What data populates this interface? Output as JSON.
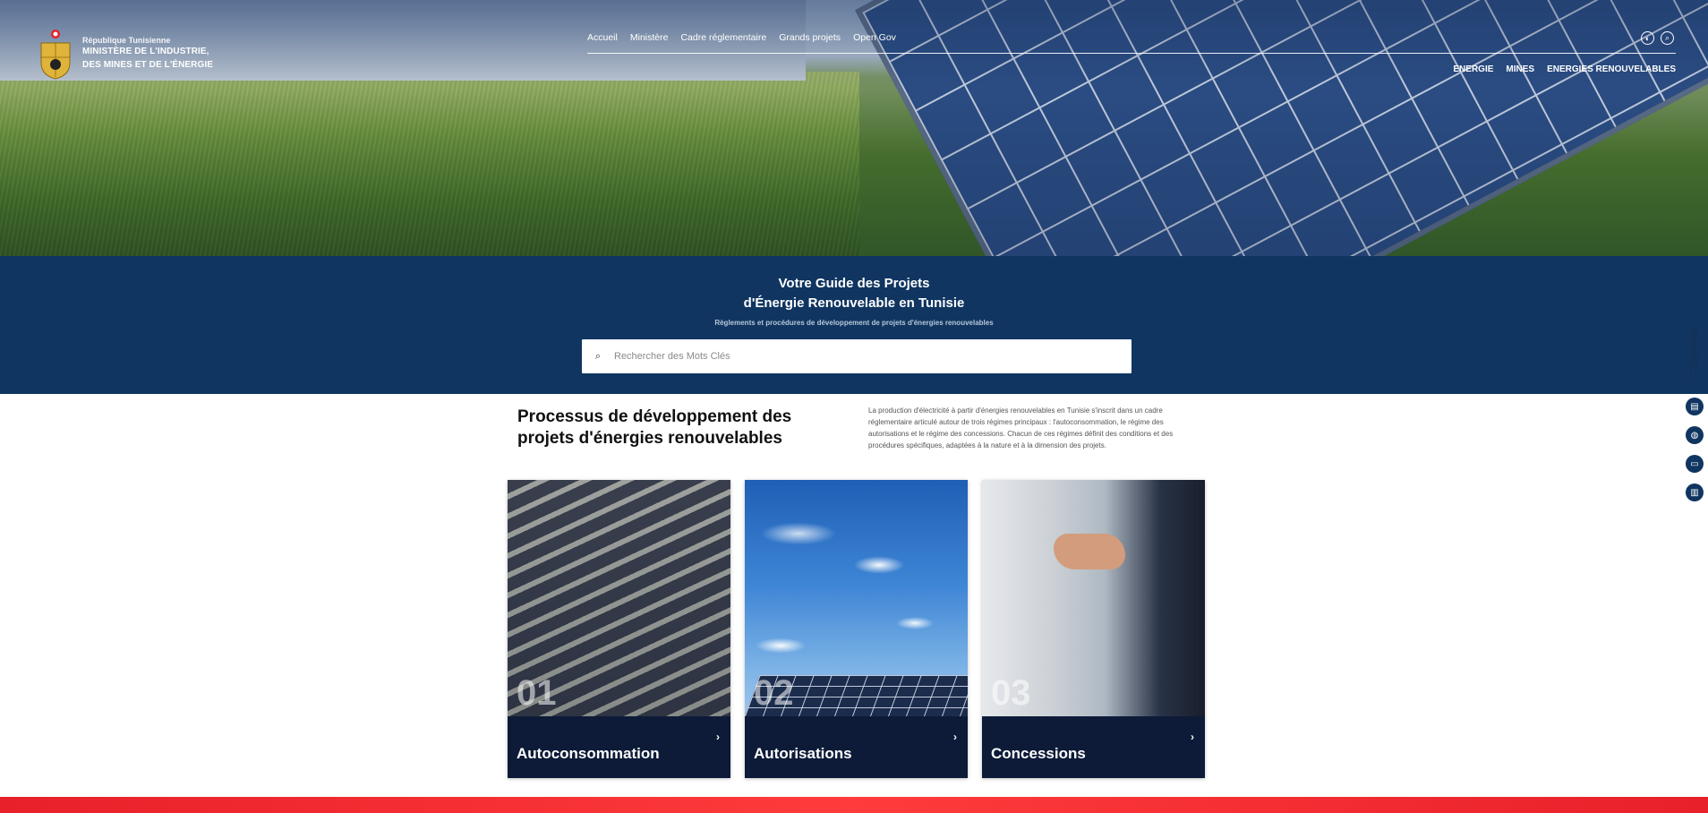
{
  "header": {
    "republic": "République Tunisienne",
    "ministry_line1": "MINISTÈRE DE L'INDUSTRIE,",
    "ministry_line2": "DES MINES ET DE L'ÉNERGIE",
    "logo_icon": "coat-of-arms-icon",
    "nav": [
      "Accueil",
      "Ministère",
      "Cadre réglementaire",
      "Grands projets",
      "Open Gov"
    ],
    "subnav": [
      "ENERGIE",
      "MINES",
      "ENERGIES RENOUVELABLES"
    ],
    "icons": [
      "language-icon",
      "search-icon"
    ]
  },
  "guide": {
    "title_line1": "Votre Guide des Projets",
    "title_line2": "d'Énergie Renouvelable en Tunisie",
    "subtitle": "Règlements et procédures de développement de projets d'énergies renouvelables",
    "search_placeholder": "Rechercher des Mots Clés"
  },
  "side": {
    "tab_label": "LIEN RAPIDE",
    "icons": [
      "document-icon",
      "chat-icon",
      "folder-icon",
      "map-icon"
    ]
  },
  "process": {
    "title": "Processus de développement des projets d'énergies renouvelables",
    "description": "La production d'électricité à partir d'énergies renouvelables en Tunisie s'inscrit dans un cadre réglementaire articulé autour de trois régimes principaux : l'autoconsommation, le régime des autorisations et le régime des concessions. Chacun de ces régimes définit des conditions et des procédures spécifiques, adaptées à la nature et à la dimension des projets.",
    "cards": [
      {
        "num": "01",
        "label": "Autoconsommation"
      },
      {
        "num": "02",
        "label": "Autorisations"
      },
      {
        "num": "03",
        "label": "Concessions"
      }
    ]
  },
  "colors": {
    "band": "#0f3560",
    "card_footer": "#0d1b38",
    "accent_red": "#e8202a"
  }
}
